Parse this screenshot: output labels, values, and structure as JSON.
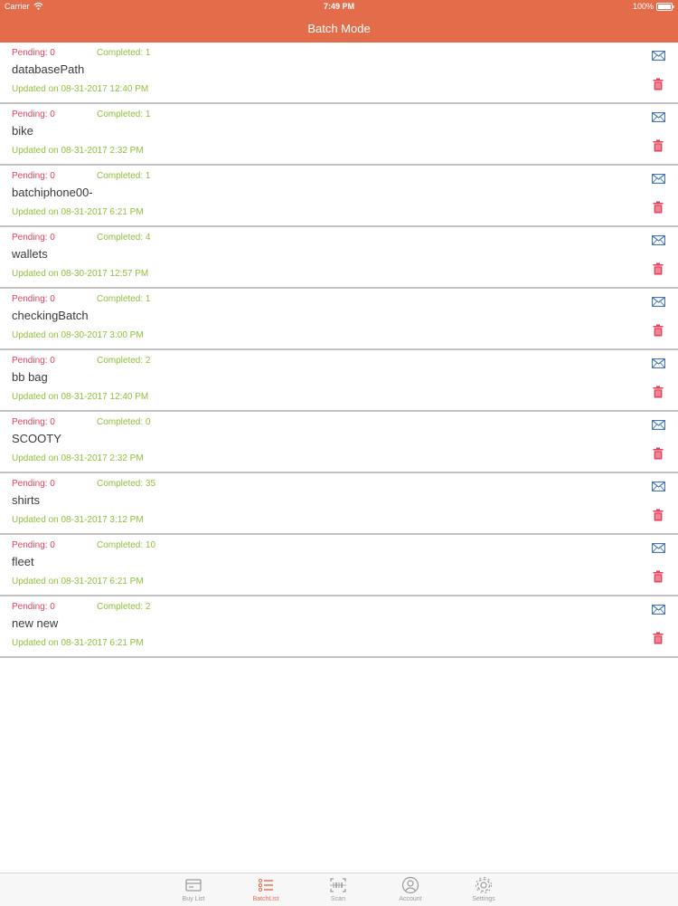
{
  "status_bar": {
    "carrier": "Carrier",
    "time": "7:49 PM",
    "battery": "100%"
  },
  "header": {
    "title": "Batch Mode"
  },
  "colors": {
    "accent": "#e36d4a",
    "pending": "#e4415b",
    "completed": "#8fbf3a",
    "mail": "#3d6fb4",
    "trash": "#e4415b"
  },
  "batches": [
    {
      "pending": "Pending: 0",
      "completed": "Completed: 1",
      "name": "databasePath",
      "updated": "Updated on 08-31-2017 12:40 PM"
    },
    {
      "pending": "Pending: 0",
      "completed": "Completed: 1",
      "name": "bike",
      "updated": "Updated on 08-31-2017 2:32 PM"
    },
    {
      "pending": "Pending: 0",
      "completed": "Completed: 1",
      "name": "batchiphone00-",
      "updated": "Updated on 08-31-2017 6:21 PM"
    },
    {
      "pending": "Pending: 0",
      "completed": "Completed: 4",
      "name": "wallets",
      "updated": "Updated on 08-30-2017 12:57 PM"
    },
    {
      "pending": "Pending: 0",
      "completed": "Completed: 1",
      "name": "checkingBatch",
      "updated": "Updated on 08-30-2017 3:00 PM"
    },
    {
      "pending": "Pending: 0",
      "completed": "Completed: 2",
      "name": "bb bag",
      "updated": "Updated on 08-31-2017 12:40 PM"
    },
    {
      "pending": "Pending: 0",
      "completed": "Completed: 0",
      "name": "SCOOTY",
      "updated": "Updated on 08-31-2017 2:32 PM"
    },
    {
      "pending": "Pending: 0",
      "completed": "Completed: 35",
      "name": "shirts",
      "updated": "Updated on 08-31-2017 3:12 PM"
    },
    {
      "pending": "Pending: 0",
      "completed": "Completed: 10",
      "name": "fleet",
      "updated": "Updated on 08-31-2017 6:21 PM"
    },
    {
      "pending": "Pending: 0",
      "completed": "Completed: 2",
      "name": "new new",
      "updated": "Updated on 08-31-2017 6:21 PM"
    }
  ],
  "tabbar": {
    "tabs": [
      {
        "label": "Buy List",
        "icon": "buy-list-icon"
      },
      {
        "label": "BatchList",
        "icon": "batch-list-icon",
        "active": true
      },
      {
        "label": "Scan",
        "icon": "scan-icon"
      },
      {
        "label": "Account",
        "icon": "account-icon"
      },
      {
        "label": "Settings",
        "icon": "settings-icon"
      }
    ]
  }
}
